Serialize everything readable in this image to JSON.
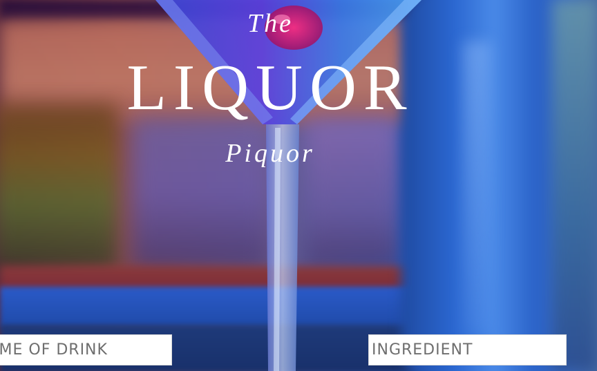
{
  "header": {
    "title_top": "The",
    "title_main": "LIQUOR",
    "title_bottom": "Piquor"
  },
  "search": {
    "drink_placeholder": "Name of Drink",
    "ingredient_placeholder": "Ingredient"
  },
  "colors": {
    "title_text": "#ffffff",
    "field_background": "#ffffff",
    "field_placeholder": "#6e6e6e"
  }
}
